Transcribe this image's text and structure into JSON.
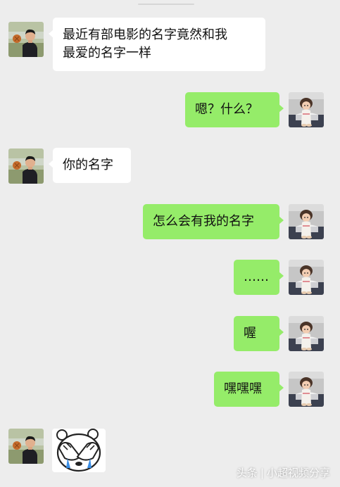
{
  "messages": [
    {
      "sender": "other",
      "text_lines": [
        "最近有部电影的名字竟然和我",
        "最爱的名字一样"
      ]
    },
    {
      "sender": "me",
      "text": "嗯？什么？"
    },
    {
      "sender": "other",
      "text": "你的名字"
    },
    {
      "sender": "me",
      "text": "怎么会有我的名字"
    },
    {
      "sender": "me",
      "text": "……"
    },
    {
      "sender": "me",
      "text": "喔"
    },
    {
      "sender": "me",
      "text": "嘿嘿嘿"
    },
    {
      "sender": "other",
      "sticker": "crying-bear-sticker"
    }
  ],
  "watermark": {
    "source": "头条",
    "separator": "|",
    "author": "小超视频分享"
  },
  "colors": {
    "background": "#ededed",
    "my_bubble": "#95ec69",
    "other_bubble": "#ffffff"
  },
  "icons": {
    "left_avatar": "boy-avatar",
    "right_avatar": "girl-avatar",
    "sticker": "crying-bear-sticker"
  }
}
